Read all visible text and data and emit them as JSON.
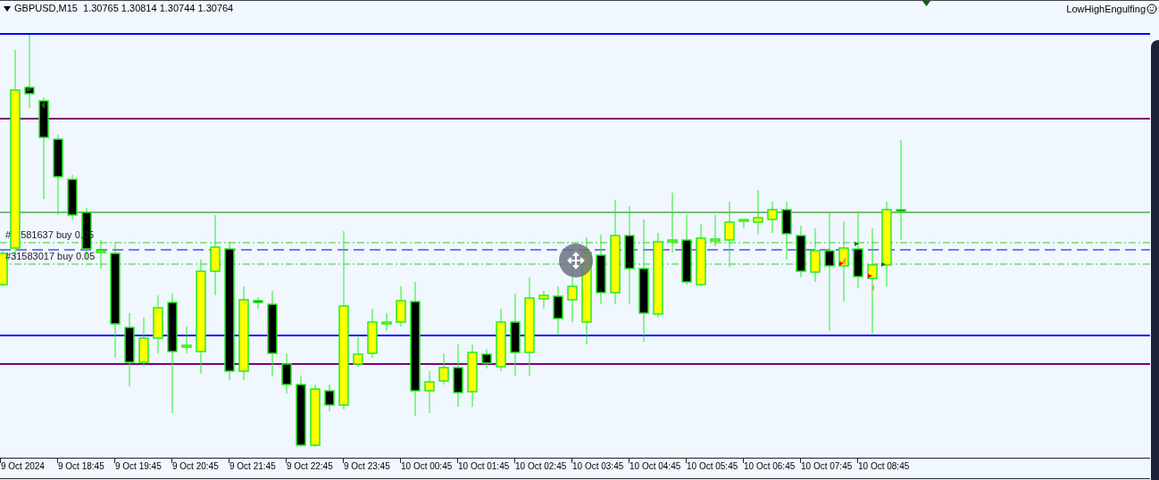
{
  "chart": {
    "title": "GBPUSD,M15  1.30765 1.30814 1.30744 1.30764",
    "indicator": "LowHighEngulfing",
    "orders": [
      {
        "parts": [
          "#",
          "581637 buy 0.05"
        ]
      },
      {
        "parts": [
          "#31583017 buy 0.05"
        ]
      }
    ],
    "x_labels": [
      "9 Oct 2024",
      "9 Oct 18:45",
      "9 Oct 19:45",
      "9 Oct 20:45",
      "9 Oct 21:45",
      "9 Oct 22:45",
      "9 Oct 23:45",
      "10 Oct 00:45",
      "10 Oct 01:45",
      "10 Oct 02:45",
      "10 Oct 03:45",
      "10 Oct 04:45",
      "10 Oct 05:45",
      "10 Oct 06:45",
      "10 Oct 07:45",
      "10 Oct 08:45"
    ]
  }
}
